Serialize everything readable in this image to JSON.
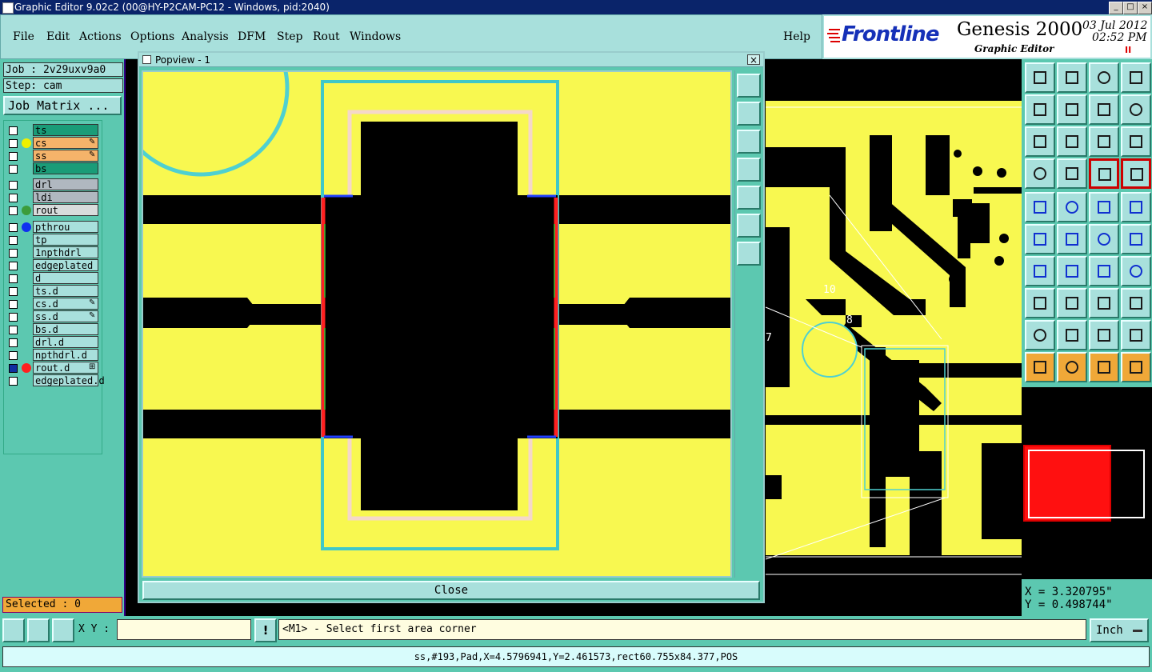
{
  "window": {
    "title": "Graphic Editor 9.02c2 (00@HY-P2CAM-PC12 - Windows, pid:2040)",
    "minimize": "_",
    "maximize": "□",
    "close": "×"
  },
  "menu": {
    "items": [
      "File",
      "Edit",
      "Actions",
      "Options",
      "Analysis",
      "DFM",
      "Step",
      "Rout",
      "Windows"
    ],
    "help": "Help"
  },
  "brand": {
    "logo": "Frontline",
    "product": "Genesis 2000",
    "subtitle": "Graphic Editor",
    "date": "03 Jul 2012",
    "time": "02:52 PM",
    "pause": "II"
  },
  "job": {
    "job_label": "Job : 2v29uxv9a0",
    "step_label": "Step: cam",
    "matrix_button": "Job Matrix ..."
  },
  "layers": [
    {
      "name": "ts",
      "color": "#1a9c78",
      "dot": "",
      "mark": ""
    },
    {
      "name": "cs",
      "color": "#f5b36a",
      "dot": "#f0f000",
      "mark": "✎"
    },
    {
      "name": "ss",
      "color": "#f5b36a",
      "dot": "",
      "mark": "✎"
    },
    {
      "name": "bs",
      "color": "#1a9c78",
      "dot": "",
      "mark": ""
    },
    {
      "name": "drl",
      "color": "#b0b8c0",
      "dot": "",
      "mark": ""
    },
    {
      "name": "ldi",
      "color": "#b0b8c0",
      "dot": "",
      "mark": ""
    },
    {
      "name": "rout",
      "color": "#d8dcdc",
      "dot": "#3c9c3c",
      "mark": ""
    },
    {
      "name": "pthrou",
      "color": "#a8e0dc",
      "dot": "#1030f0",
      "mark": ""
    },
    {
      "name": "tp",
      "color": "#a8e0dc",
      "dot": "",
      "mark": ""
    },
    {
      "name": "1npthdrl",
      "color": "#a8e0dc",
      "dot": "",
      "mark": ""
    },
    {
      "name": "edgeplated",
      "color": "#a8e0dc",
      "dot": "",
      "mark": ""
    },
    {
      "name": "d",
      "color": "#a8e0dc",
      "dot": "",
      "mark": ""
    },
    {
      "name": "ts.d",
      "color": "#a8e0dc",
      "dot": "",
      "mark": ""
    },
    {
      "name": "cs.d",
      "color": "#a8e0dc",
      "dot": "",
      "mark": "✎"
    },
    {
      "name": "ss.d",
      "color": "#a8e0dc",
      "dot": "",
      "mark": "✎"
    },
    {
      "name": "bs.d",
      "color": "#a8e0dc",
      "dot": "",
      "mark": ""
    },
    {
      "name": "drl.d",
      "color": "#a8e0dc",
      "dot": "",
      "mark": ""
    },
    {
      "name": "npthdrl.d",
      "color": "#a8e0dc",
      "dot": "",
      "mark": ""
    },
    {
      "name": "rout.d",
      "color": "#a8e0dc",
      "dot": "#ff2020",
      "mark": "⊞"
    },
    {
      "name": "edgeplated.d",
      "color": "#a8e0dc",
      "dot": "",
      "mark": ""
    }
  ],
  "selected": "Selected : 0",
  "popview": {
    "title": "Popview - 1",
    "close_button": "Close"
  },
  "canvas": {
    "label_10": "10",
    "label_8": "8",
    "label_7": "7"
  },
  "coords": {
    "x": "X = 3.320795\"",
    "y": "Y = 0.498744\""
  },
  "bottom": {
    "xy_label": "X Y :",
    "xy_value": "",
    "warn": "!",
    "prompt": "<M1> - Select first area corner",
    "units": "Inch"
  },
  "status": "ss,#193,Pad,X=4.5796941,Y=2.461573,rect60.755x84.377,POS"
}
